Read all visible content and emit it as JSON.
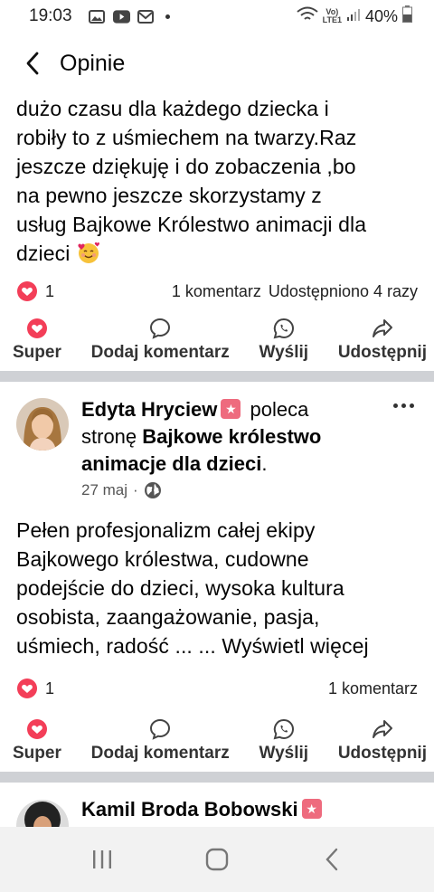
{
  "status": {
    "time": "19:03",
    "network": "VoLTE1 LTE1",
    "battery": "40%"
  },
  "header": {
    "title": "Opinie"
  },
  "post1": {
    "text_lines": [
      "dużo czasu dla każdego dziecka i",
      "robiły to z uśmiechem na twarzy.Raz",
      "jeszcze dziękuję i do zobaczenia ,bo",
      "na pewno jeszcze skorzystamy z",
      "usług Bajkowe Królestwo animacji dla",
      "dzieci"
    ],
    "reaction_count": "1",
    "comments": "1 komentarz",
    "shares": "Udostępniono 4 razy"
  },
  "actions": {
    "super": "Super",
    "comment": "Dodaj komentarz",
    "send": "Wyślij",
    "share": "Udostępnij"
  },
  "post2": {
    "author": "Edyta Hryciew",
    "recommends": "poleca",
    "page_prefix": "stronę",
    "page_name_1": "Bajkowe królestwo",
    "page_name_2": "animacje dla dzieci",
    "date": "27 maj",
    "text_lines": [
      "Pełen profesjonalizm całej ekipy",
      "Bajkowego królestwa, cudowne",
      "podejście do dzieci, wysoka kultura",
      "osobista, zaangażowanie, pasja,",
      "uśmiech, radość ... ... Wyświetl więcej"
    ],
    "reaction_count": "1",
    "comments": "1 komentarz"
  },
  "post3": {
    "author": "Kamil Broda Bobowski"
  },
  "colors": {
    "love": "#f33e58",
    "badge": "#ee6b7e",
    "separator": "#cfd1d5"
  }
}
